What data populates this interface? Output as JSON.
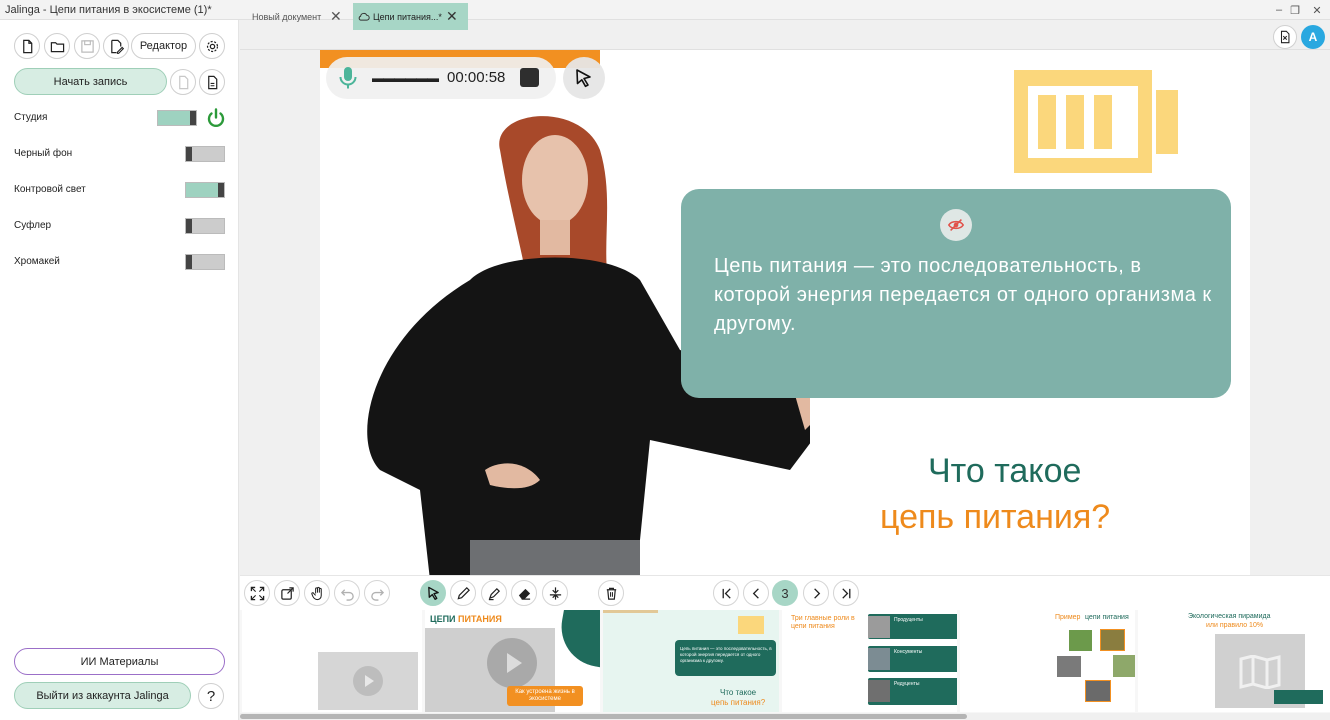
{
  "window": {
    "title": "Jalinga - Цепи питания в экосистеме (1)*",
    "min": "–",
    "restore": "❐",
    "close": "✕"
  },
  "sidebar": {
    "editor_label": "Редактор",
    "start_record_label": "Начать запись",
    "settings": [
      {
        "label": "Студия",
        "on": true
      },
      {
        "label": "Черный фон",
        "on": false
      },
      {
        "label": "Контровой свет",
        "on": true
      },
      {
        "label": "Суфлер",
        "on": false
      },
      {
        "label": "Хромакей",
        "on": false
      }
    ],
    "ai_materials_label": "ИИ Материалы",
    "logout_label": "Выйти из аккаунта Jalinga",
    "help_label": "?"
  },
  "tabs": [
    {
      "label": "Новый документ",
      "active": false
    },
    {
      "label": "Цепи питания...*",
      "active": true
    }
  ],
  "user": {
    "avatar_letter": "A",
    "accent": "#29a8e0"
  },
  "recording": {
    "time": "00:00:58",
    "level": "▬▬▬▬▬▬"
  },
  "slide": {
    "definition": "Цепь питания — это последовательность, в которой энергия передается от одного организма к другому.",
    "question_line1": "Что такое",
    "question_line2": "цепь питания?",
    "colors": {
      "teal": "#7fb1a9",
      "dark_green": "#1f6b5c",
      "orange": "#ee8a1c",
      "yellow": "#f8d27a"
    }
  },
  "pager": {
    "current": "3"
  },
  "thumbnails": {
    "t2_title_a": "ЦЕПИ",
    "t2_title_b": "ПИТАНИЯ",
    "t2_button": "Как устроена жизнь в экосистеме",
    "t3_text": "Цепь питания — это последовательность, в которой энергия передается от одного организма к другому.",
    "t3_q1": "Что такое",
    "t3_q2": "цепь питания?",
    "t4_title": "Три главные роли в цепи питания",
    "t4_items": [
      "Продуценты",
      "Консументы",
      "Редуценты"
    ],
    "t5_title_a": "Пример",
    "t5_title_b": "цепи питания",
    "t6_title_a": "Экологическая пирамида",
    "t6_title_b": "или правило 10%"
  }
}
